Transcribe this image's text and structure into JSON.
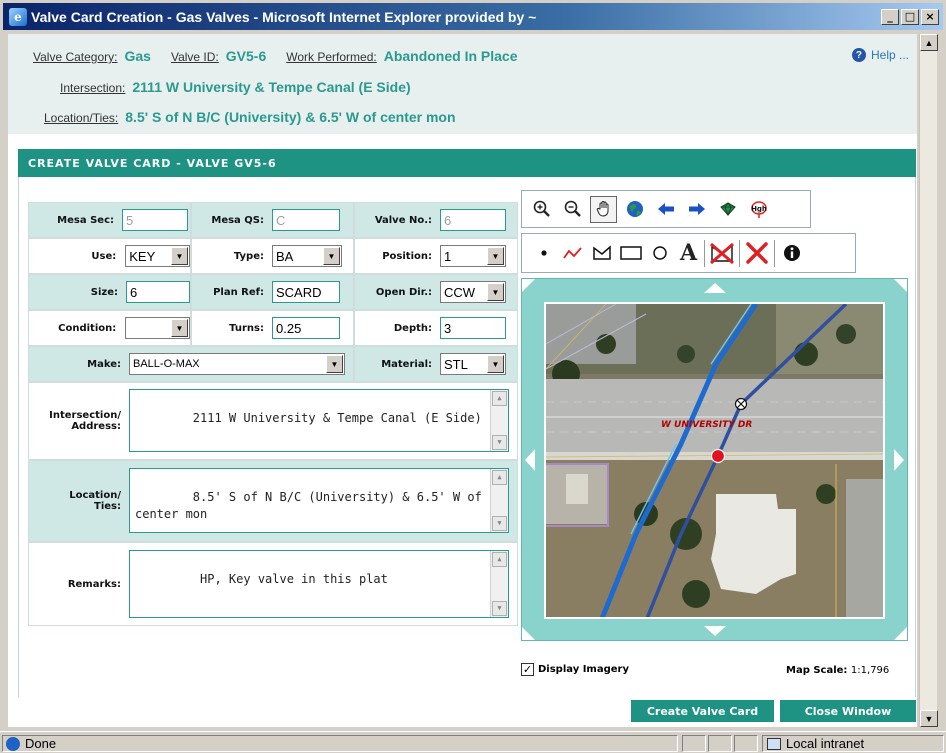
{
  "window": {
    "title": "Valve Card Creation - Gas Valves - Microsoft Internet Explorer provided by ~",
    "minimize": "_",
    "maximize": "□",
    "close": "×"
  },
  "header": {
    "valve_category_label": "Valve Category:",
    "valve_category": "Gas",
    "valve_id_label": "Valve ID:",
    "valve_id": "GV5-6",
    "work_performed_label": "Work Performed:",
    "work_performed": "Abandoned In Place",
    "intersection_label": "Intersection:",
    "intersection": "2111 W University & Tempe Canal (E Side)",
    "location_label": "Location/Ties:",
    "location": "8.5' S of N B/C (University) & 6.5' W of center mon",
    "help": "Help ..."
  },
  "section_title": "CREATE VALVE CARD - VALVE GV5-6",
  "form": {
    "mesa_sec_label": "Mesa Sec:",
    "mesa_sec": "5",
    "mesa_qs_label": "Mesa QS:",
    "mesa_qs": "C",
    "valve_no_label": "Valve No.:",
    "valve_no": "6",
    "use_label": "Use:",
    "use": "KEY",
    "type_label": "Type:",
    "type": "BA",
    "position_label": "Position:",
    "position": "1",
    "size_label": "Size:",
    "size": "6",
    "plan_ref_label": "Plan Ref:",
    "plan_ref": "SCARD",
    "open_dir_label": "Open Dir.:",
    "open_dir": "CCW",
    "condition_label": "Condition:",
    "condition": "",
    "turns_label": "Turns:",
    "turns": "0.25",
    "depth_label": "Depth:",
    "depth": "3",
    "make_label": "Make:",
    "make": "BALL-O-MAX",
    "material_label": "Material:",
    "material": "STL",
    "intersection_label_1": "Intersection/",
    "intersection_label_2": "Address:",
    "intersection_value": "2111 W University & Tempe Canal (E Side)",
    "location_label_1": "Location/",
    "location_label_2": "Ties:",
    "location_value": "8.5' S of N B/C (University) & 6.5' W of center mon",
    "remarks_label": "Remarks:",
    "remarks_value": " HP, Key valve in this plat"
  },
  "map": {
    "street_label": "W UNIVERSITY DR",
    "display_imagery_label": "Display Imagery",
    "display_imagery_checked": true,
    "check_glyph": "✓",
    "map_scale_label": "Map Scale:",
    "map_scale_value": "1:1,796",
    "tools_row1": [
      "zoom-in-icon",
      "zoom-out-icon",
      "pan-hand-icon",
      "full-extent-globe-icon",
      "back-arrow-icon",
      "forward-arrow-icon",
      "identify-icon",
      "high-icon"
    ],
    "tools_row2": [
      "point-icon",
      "line-icon",
      "polygon-icon",
      "rectangle-icon",
      "circle-icon",
      "text-icon",
      "clear-selected-icon",
      "clear-all-icon",
      "info-icon"
    ],
    "text_tool": "A",
    "hi_tool": "Hgh",
    "colors": {
      "road": "#2f4fa0",
      "canal": "#1d6ad0",
      "valve_marker": "#e0141c"
    }
  },
  "buttons": {
    "create": "Create Valve Card",
    "close": "Close Window"
  },
  "statusbar": {
    "status": "Done",
    "zone": "Local intranet"
  }
}
